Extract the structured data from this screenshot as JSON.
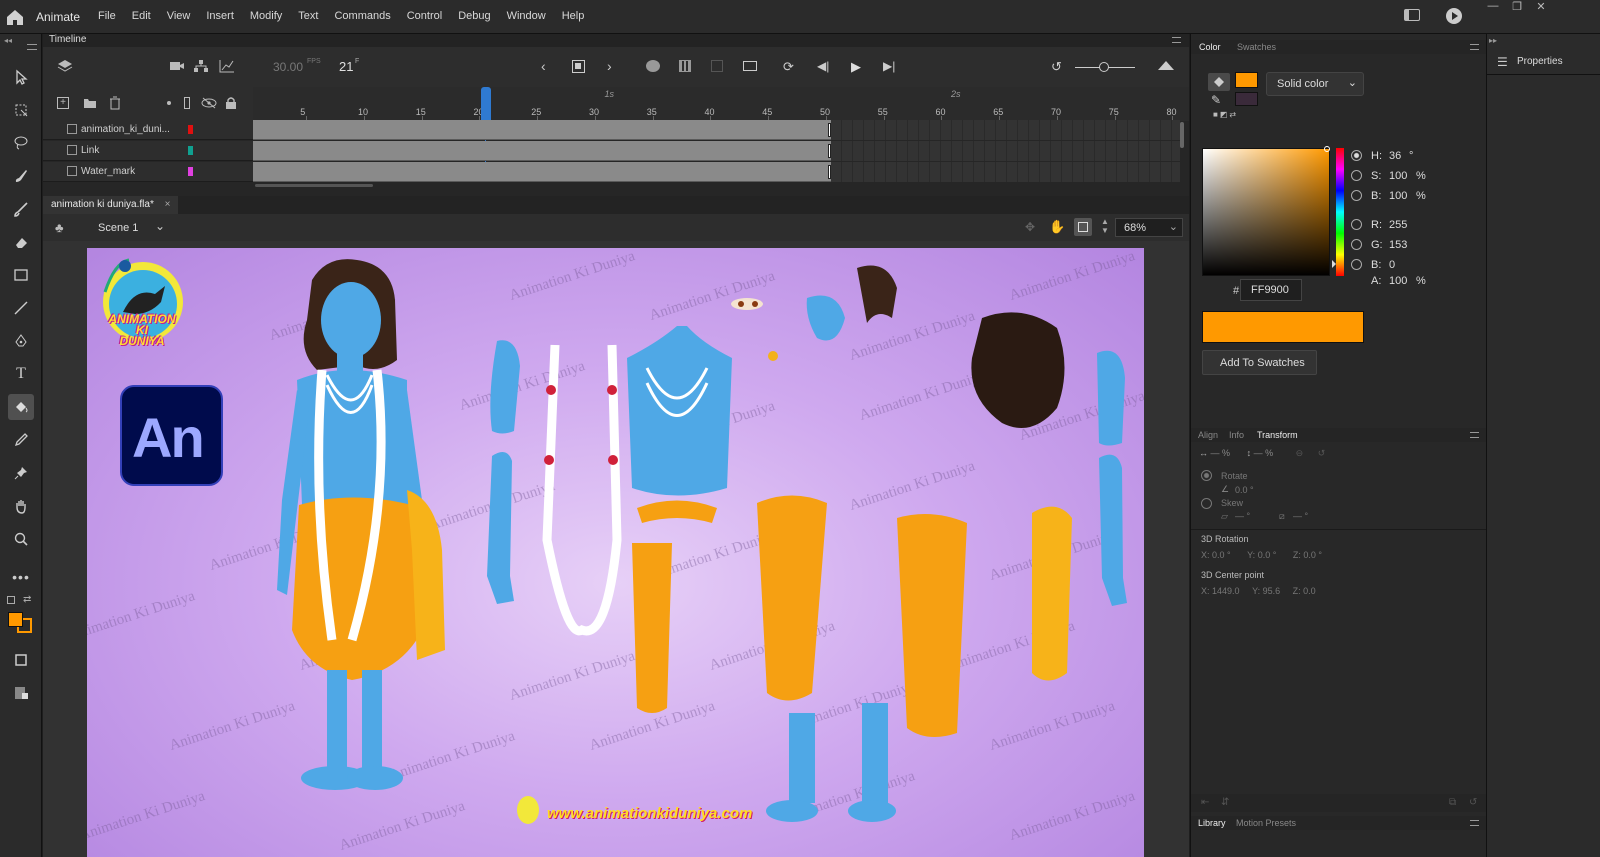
{
  "app": {
    "name": "Animate"
  },
  "menu": [
    "File",
    "Edit",
    "View",
    "Insert",
    "Modify",
    "Text",
    "Commands",
    "Control",
    "Debug",
    "Window",
    "Help"
  ],
  "timeline": {
    "title": "Timeline",
    "fps": "30.00",
    "fps_unit": "FPS",
    "frame": "21",
    "frame_unit": "F",
    "ruler_ticks": [
      "5",
      "10",
      "15",
      "20",
      "25",
      "30",
      "35",
      "40",
      "45",
      "50",
      "55",
      "60",
      "65",
      "70",
      "75",
      "80"
    ],
    "second_marks": [
      "1s",
      "2s"
    ],
    "playhead_frame": 21,
    "last_frame": 50,
    "layers": [
      {
        "name": "animation_ki_duni...",
        "color": "#e01010"
      },
      {
        "name": "Link",
        "color": "#10a090"
      },
      {
        "name": "Water_mark",
        "color": "#e040e0"
      }
    ]
  },
  "document": {
    "tab": "animation ki duniya.fla*",
    "close": "×"
  },
  "scene": {
    "name": "Scene 1",
    "zoom": "68%"
  },
  "stage": {
    "logo_text": [
      "ANIMATION",
      "KI",
      "DUNIYA"
    ],
    "an_badge": "An",
    "watermark": "Animation Ki Duniya",
    "footer_url": "www.animationkiduniya.com"
  },
  "color_panel": {
    "tabs": [
      "Color",
      "Swatches"
    ],
    "fill_type": "Solid color",
    "fill_color": "#FF9900",
    "stroke_color": "#3a2a3a",
    "h": "36",
    "h_unit": "°",
    "s": "100",
    "s_unit": "%",
    "b": "100",
    "b_unit": "%",
    "r": "255",
    "g": "153",
    "bl": "0",
    "a": "100",
    "a_unit": "%",
    "hex_label": "#",
    "hex": "FF9900",
    "add_swatch": "Add To Swatches",
    "labels": {
      "h": "H:",
      "s": "S:",
      "b": "B:",
      "r": "R:",
      "g": "G:",
      "bl": "B:",
      "a": "A:"
    }
  },
  "transform_panel": {
    "tabs": [
      "Align",
      "Info",
      "Transform"
    ],
    "width_val": "—",
    "height_val": "—",
    "pct": "%",
    "rotate_label": "Rotate",
    "rotate_val": "0.0 °",
    "skew_label": "Skew",
    "skew_h": "— °",
    "skew_v": "— °",
    "rotation3d_label": "3D Rotation",
    "rot3d": {
      "x": "0.0 °",
      "y": "0.0 °",
      "z": "0.0 °"
    },
    "center3d_label": "3D Center point",
    "center3d": {
      "x": "1449.0",
      "y": "95.6",
      "z": "0.0"
    },
    "axis": {
      "x": "X:",
      "y": "Y:",
      "z": "Z:"
    }
  },
  "library_panel": {
    "tabs": [
      "Library",
      "Motion Presets"
    ]
  },
  "properties_panel": {
    "title": "Properties"
  }
}
